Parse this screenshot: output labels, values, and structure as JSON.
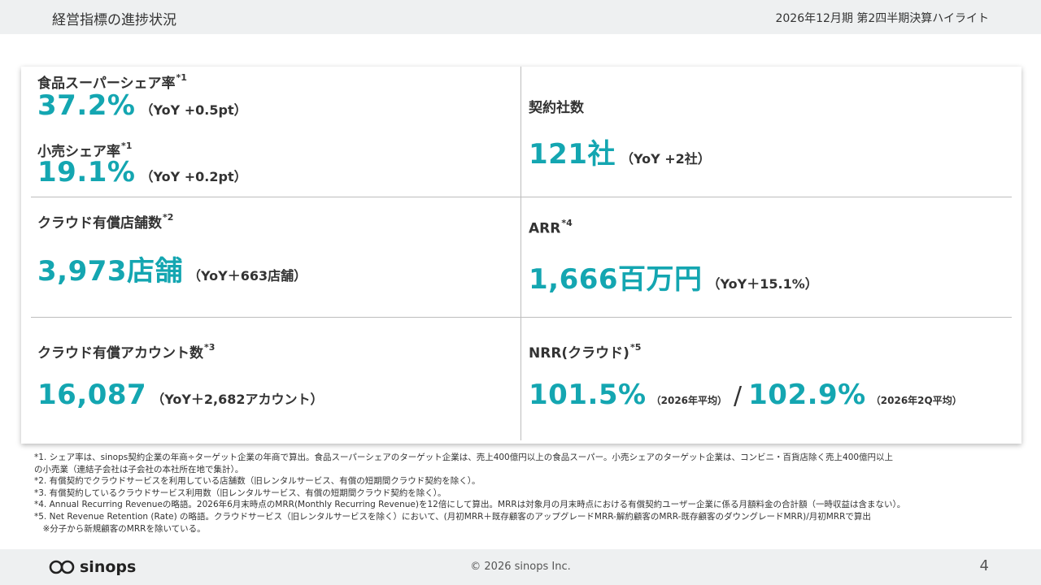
{
  "header": {
    "title": "経営指標の進捗状況",
    "period": "2026年12月期 第2四半期決算ハイライト"
  },
  "metrics": {
    "food_share": {
      "label": "食品スーパーシェア率",
      "note": "*1",
      "value": "37.2%",
      "yoy": "（YoY +0.5pt）"
    },
    "retail_share": {
      "label": "小売シェア率",
      "note": "*1",
      "value": "19.1%",
      "yoy": "（YoY +0.2pt）"
    },
    "contracts": {
      "label": "契約社数",
      "value": "121社",
      "yoy": "（YoY +2社）"
    },
    "stores": {
      "label": "クラウド有償店舗数",
      "note": "*2",
      "value": "3,973店舗",
      "yoy": "（YoY＋663店舗）"
    },
    "arr": {
      "label": "ARR",
      "note": "*4",
      "value": "1,666百万円",
      "yoy": "（YoY＋15.1%）"
    },
    "accounts": {
      "label": "クラウド有償アカウント数",
      "note": "*3",
      "value": "16,087",
      "yoy": "（YoY＋2,682アカウント）"
    },
    "nrr": {
      "label": "NRR(クラウド)",
      "note": "*5",
      "value1": "101.5%",
      "sub1": "（2026年平均）",
      "slash": "/",
      "value2": "102.9%",
      "sub2": "（2026年2Q平均）"
    }
  },
  "notes": [
    "*1. シェア率は、sinops契約企業の年商÷ターゲット企業の年商で算出。食品スーパーシェアのターゲット企業は、売上400億円以上の食品スーパー。小売シェアのターゲット企業は、コンビニ・百貨店除く売上400億円以上",
    "の小売業（連結子会社は子会社の本社所在地で集計）。",
    "*2. 有償契約でクラウドサービスを利用している店舗数（旧レンタルサービス、有償の短期間クラウド契約を除く）。",
    "*3. 有償契約しているクラウドサービス利用数（旧レンタルサービス、有償の短期間クラウド契約を除く）。",
    "*4. Annual Recurring Revenueの略語。2026年6月末時点のMRR(Monthly Recurring Revenue)を12倍にして算出。MRRは対象月の月末時点における有償契約ユーザー企業に係る月額料金の合計額（一時収益は含まない）。",
    "*5. Net Revenue Retention (Rate) の略語。クラウドサービス（旧レンタルサービスを除く）において、(月初MRR＋既存顧客のアップグレードMRR-解約顧客のMRR-既存顧客のダウングレードMRR)/月初MRRで算出",
    "　※分子から新規顧客のMRRを除いている。"
  ],
  "footer": {
    "logo_text": "sinops",
    "logo_icon": "infinity-logo-icon",
    "copyright": "© 2026 sinops Inc.",
    "page_number": "4"
  },
  "colors": {
    "accent": "#14a6b1",
    "header_bg": "#eef0f1",
    "divider": "#bdbdbd"
  }
}
